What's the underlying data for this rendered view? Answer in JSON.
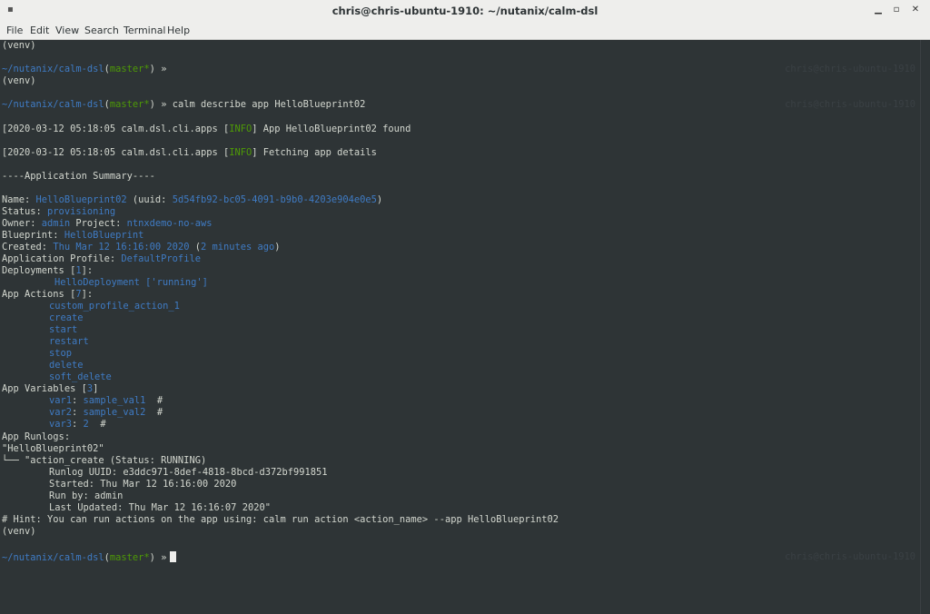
{
  "window": {
    "title": "chris@chris-ubuntu-1910: ~/nutanix/calm-dsl",
    "menu": [
      "File",
      "Edit",
      "View",
      "Search",
      "Terminal",
      "Help"
    ]
  },
  "prompt": {
    "path": "~/nutanix/calm-dsl",
    "branch": "master*",
    "symbol": "»",
    "host": "chris@chris-ubuntu-1910"
  },
  "terminal": {
    "venv": "(venv)",
    "command": "calm describe app HelloBlueprint02",
    "log1_prefix": "[2020-03-12 05:18:05 calm.dsl.cli.apps [",
    "log_level": "INFO",
    "log1_suffix": "] App HelloBlueprint02 found",
    "log2_prefix": "[2020-03-12 05:18:05 calm.dsl.cli.apps [",
    "log2_suffix": "] Fetching app details",
    "summary_header": "----Application Summary----",
    "name_label": "Name: ",
    "name_value": "HelloBlueprint02",
    "uuid_label": " (uuid: ",
    "uuid_value": "5d54fb92-bc05-4091-b9b0-4203e904e0e5",
    "uuid_close": ")",
    "status_label": "Status: ",
    "status_value": "provisioning",
    "owner_label": "Owner: ",
    "owner_value": "admin",
    "project_label": " Project: ",
    "project_value": "ntnxdemo-no-aws",
    "blueprint_label": "Blueprint: ",
    "blueprint_value": "HelloBlueprint",
    "created_label": "Created: ",
    "created_value": "Thu Mar 12 16:16:00 2020",
    "created_paren_open": " (",
    "created_ago": "2 minutes ago",
    "created_paren_close": ")",
    "profile_label": "Application Profile: ",
    "profile_value": "DefaultProfile",
    "deployments_label": "Deployments [",
    "deployments_count": "1",
    "deployments_close": "]:",
    "deployment_item": "HelloDeployment ['running']",
    "actions_label": "App Actions [",
    "actions_count": "7",
    "actions_close": "]:",
    "actions": [
      "custom_profile_action_1",
      "create",
      "start",
      "restart",
      "stop",
      "delete",
      "soft_delete"
    ],
    "variables_label": "App Variables [",
    "variables_count": "3",
    "variables_close": "]",
    "variables": [
      {
        "name": "var1",
        "value": "sample_val1",
        "hash": "  #"
      },
      {
        "name": "var2",
        "value": "sample_val2",
        "hash": "  #"
      },
      {
        "name": "var3",
        "value": "2",
        "hash": "  #"
      }
    ],
    "runlogs_label": "App Runlogs:",
    "runlogs_app": "\"HelloBlueprint02\"",
    "runlog_tree": "└── \"action_create (Status: RUNNING)",
    "runlog_uuid": "Runlog UUID: e3ddc971-8def-4818-8bcd-d372bf991851",
    "runlog_started": "Started: Thu Mar 12 16:16:00 2020",
    "runlog_runby": "Run by: admin",
    "runlog_updated": "Last Updated: Thu Mar 12 16:16:07 2020\"",
    "hint": "# Hint: You can run actions on the app using: calm run action <action_name> --app HelloBlueprint02"
  }
}
